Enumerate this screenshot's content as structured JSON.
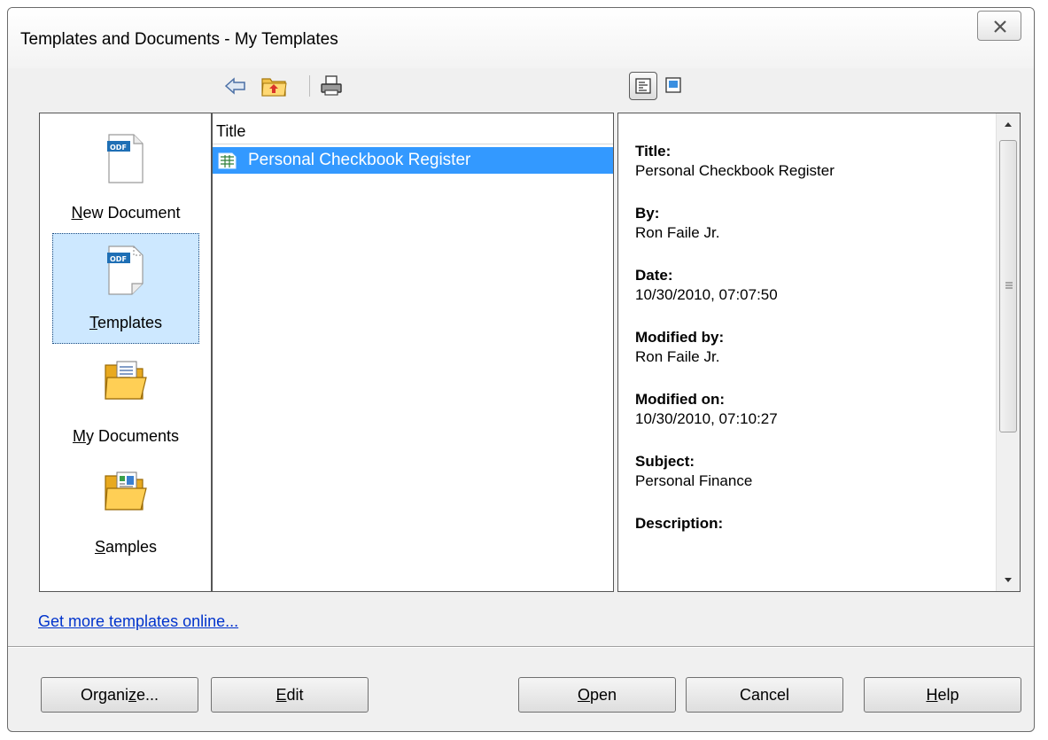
{
  "window": {
    "title": "Templates and Documents - My Templates"
  },
  "toolbar": {
    "icons": [
      "back-arrow-icon",
      "folder-up-icon",
      "print-icon",
      "details-view-icon",
      "preview-view-icon"
    ]
  },
  "categories": [
    {
      "label_first": "N",
      "label_rest": "ew Document",
      "icon": "odf-document-icon",
      "selected": false
    },
    {
      "label_first": "T",
      "label_rest": "emplates",
      "icon": "odf-template-icon",
      "selected": true
    },
    {
      "label_first": "M",
      "label_rest": "y Documents",
      "icon": "folder-documents-icon",
      "selected": false
    },
    {
      "label_first": "S",
      "label_rest": "amples",
      "icon": "folder-samples-icon",
      "selected": false
    }
  ],
  "list": {
    "column_header": "Title",
    "items": [
      {
        "title": "Personal Checkbook Register",
        "icon": "spreadsheet-template-icon",
        "selected": true
      }
    ]
  },
  "preview": {
    "properties": [
      {
        "label": "Title:",
        "value": "Personal Checkbook Register"
      },
      {
        "label": "By:",
        "value": "Ron Faile Jr."
      },
      {
        "label": "Date:",
        "value": "10/30/2010, 07:07:50"
      },
      {
        "label": "Modified by:",
        "value": "Ron Faile Jr."
      },
      {
        "label": "Modified on:",
        "value": "10/30/2010, 07:10:27"
      },
      {
        "label": "Subject:",
        "value": "Personal Finance"
      },
      {
        "label": "Description:",
        "value": ""
      }
    ]
  },
  "link": {
    "text": "Get more templates online..."
  },
  "buttons": {
    "organize": {
      "pre": "Organi",
      "u": "z",
      "post": "e..."
    },
    "edit": {
      "pre": "",
      "u": "E",
      "post": "dit"
    },
    "open": {
      "pre": "",
      "u": "O",
      "post": "pen"
    },
    "cancel": {
      "pre": "Cancel",
      "u": "",
      "post": ""
    },
    "help": {
      "pre": "",
      "u": "H",
      "post": "elp"
    }
  },
  "colors": {
    "selection": "#3399ff",
    "category_selected": "#cde8ff",
    "link": "#0033cc"
  }
}
